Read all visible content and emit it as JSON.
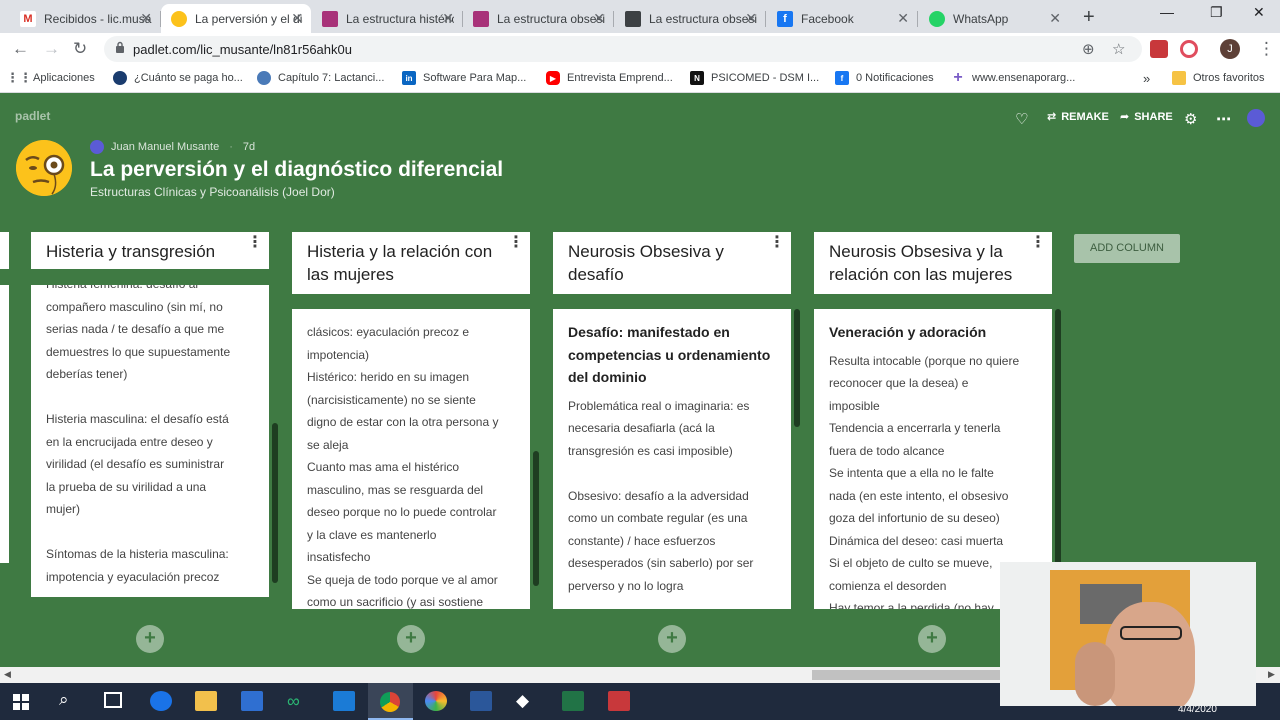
{
  "browser": {
    "tabs": [
      {
        "title": "Recibidos - lic.musante",
        "fav": "M",
        "color": "#d93025",
        "active": false
      },
      {
        "title": "La perversión y el diagnóstico",
        "fav": "",
        "color": "#fcc21b",
        "active": true
      },
      {
        "title": "La estructura histérica",
        "fav": "",
        "color": "#a83279",
        "active": false
      },
      {
        "title": "La estructura obsesiva",
        "fav": "",
        "color": "#a83279",
        "active": false
      },
      {
        "title": "La estructura obsesiva",
        "fav": "",
        "color": "#3c4043",
        "active": false
      },
      {
        "title": "Facebook",
        "fav": "f",
        "color": "#1877f2",
        "active": false
      },
      {
        "title": "WhatsApp",
        "fav": "",
        "color": "#25d366",
        "active": false
      }
    ],
    "url": "padlet.com/lic_musante/ln81r56ahk0u",
    "profile_initial": "J",
    "bookmarks": [
      {
        "label": "Aplicaciones",
        "color": "#5f6368"
      },
      {
        "label": "¿Cuánto se paga ho...",
        "color": "#1a3c6e"
      },
      {
        "label": "Capítulo 7: Lactanci...",
        "color": "#4a7ab8"
      },
      {
        "label": "Software Para Map...",
        "color": "#0a66c2"
      },
      {
        "label": "Entrevista Emprend...",
        "color": "#ff0000"
      },
      {
        "label": "PSICOMED - DSM I...",
        "color": "#111111"
      },
      {
        "label": "0 Notificaciones",
        "color": "#1877f2"
      },
      {
        "label": "www.ensenaporarg...",
        "color": "#7a5cc7"
      }
    ],
    "other_bookmarks": "Otros favoritos"
  },
  "padlet": {
    "logo": "padlet",
    "actions": {
      "remake": "REMAKE",
      "share": "SHARE"
    },
    "author": "Juan Manuel Musante",
    "age": "7d",
    "title": "La perversión y el diagnóstico diferencial",
    "subtitle": "Estructuras Clínicas y Psicoanálisis (Joel Dor)",
    "add_column": "ADD COLUMN",
    "columns": [
      {
        "title": "Histeria y transgresión",
        "card_title": "",
        "card_body": "Histeria femenina: desafío al\ncompañero masculino (sin mí, no\nserias nada / te desafío a que me\ndemuestres lo que supuestamente\ndeberías tener)\n\nHisteria masculina: el desafío está\nen la encrucijada entre deseo y\nvirilidad (el desafío es suministrar\nla prueba de su virilidad a una\nmujer)\n\nSíntomas de la histeria masculina:\nimpotencia y eyaculación precoz"
      },
      {
        "title": "Histeria y la relación con las mujeres",
        "card_title": "",
        "card_body": "clásicos: eyaculación precoz e\nimpotencia)\nHistérico: herido en su imagen\n(narcisisticamente) no se siente\ndigno de estar con la otra persona y\nse aleja\nCuanto mas ama el histérico\nmasculino, mas se resguarda del\ndeseo porque no lo puede controlar\ny la clave es mantenerlo\ninsatisfecho\nSe queja de todo porque ve al amor\ncomo un sacrificio (y asi sostiene"
      },
      {
        "title": "Neurosis Obsesiva y desafío",
        "card_title": "Desafío: manifestado en competencias u ordenamiento del dominio",
        "card_body": "Problemática real o imaginaria: es\nnecesaria desafiarla (acá la\ntransgresión es casi imposible)\n\nObsesivo: desafío a la adversidad\ncomo un combate regular (es una\nconstante) / hace esfuerzos\ndesesperados (sin saberlo) por ser\nperverso y no lo logra"
      },
      {
        "title": "Neurosis Obsesiva y la relación con las mujeres",
        "card_title": "Veneración y adoración",
        "card_body": "Resulta intocable (porque no quiere\nreconocer que la desea) e\nimposible\nTendencia a encerrarla y tenerla\nfuera de todo alcance\nSe intenta que a ella no le falte\nnada (en este intento, el obsesivo\ngoza del infortunio de su deseo)\nDinámica del deseo: casi muerta\nSi el objeto de culto se mueve,\ncomienza el desorden\nHay temor a la perdida (no hay"
      }
    ]
  },
  "taskbar": {
    "date": "4/4/2020"
  }
}
